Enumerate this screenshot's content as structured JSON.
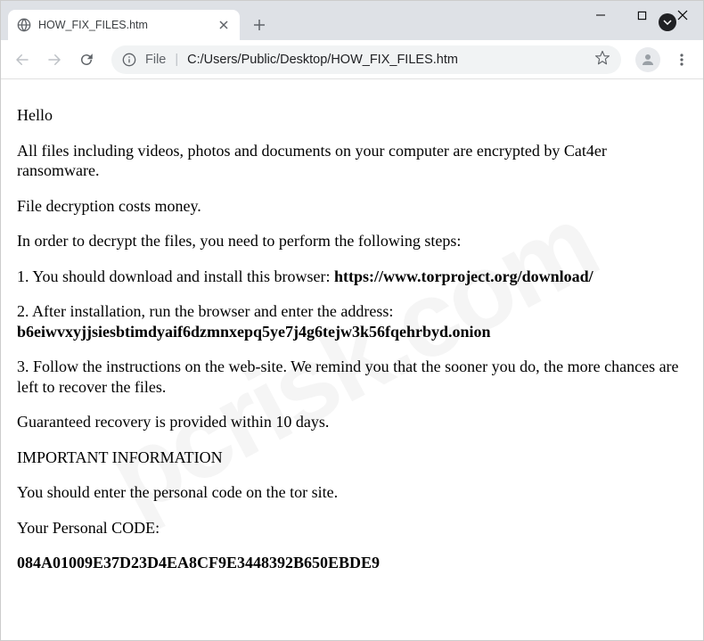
{
  "window": {
    "tab_title": "HOW_FIX_FILES.htm",
    "new_tab_glyph": "+",
    "minimize": "─",
    "maximize": "☐",
    "close": "✕"
  },
  "address": {
    "file_label": "File",
    "separator": "|",
    "url": "C:/Users/Public/Desktop/HOW_FIX_FILES.htm"
  },
  "body": {
    "hello": "Hello",
    "p1": "All files including videos, photos and documents on your computer are encrypted by Cat4er ransomware.",
    "p2": "File decryption costs money.",
    "p3": "In order to decrypt the files, you need to perform the following steps:",
    "s1a": "1. You should download and install this browser: ",
    "s1b": "https://www.torproject.org/download/",
    "s2a": "2. After installation, run the browser and enter the address:",
    "s2b": "b6eiwvxyjjsiesbtimdyaif6dzmnxepq5ye7j4g6tejw3k56fqehrbyd.onion",
    "s3": "3. Follow the instructions on the web-site. We remind you that the sooner you do, the more chances are left to recover the files.",
    "p4": "Guaranteed recovery is provided within 10 days.",
    "p5": "IMPORTANT INFORMATION",
    "p6": "You should enter the personal code on the tor site.",
    "p7": "Your Personal CODE:",
    "code": "084A01009E37D23D4EA8CF9E3448392B650EBDE9"
  },
  "watermark": "pcrisk.com"
}
